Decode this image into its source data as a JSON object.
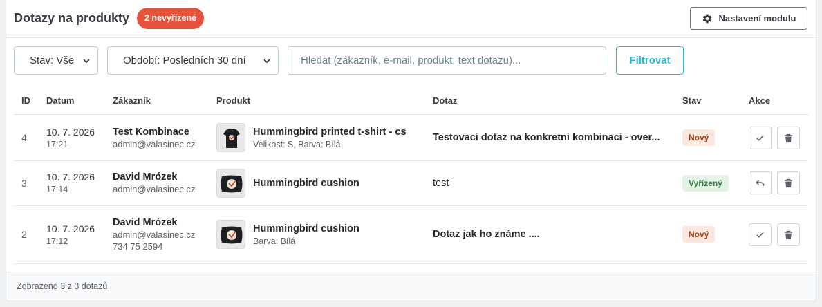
{
  "header": {
    "title": "Dotazy na produkty",
    "pending_badge": "2 nevyřízené",
    "settings_button": "Nastavení modulu"
  },
  "filters": {
    "state_select": "Stav: Vše",
    "period_select": "Období: Posledních 30 dní",
    "search_placeholder": "Hledat (zákazník, e-mail, produkt, text dotazu)...",
    "filter_button": "Filtrovat"
  },
  "table": {
    "columns": [
      "ID",
      "Datum",
      "Zákazník",
      "Produkt",
      "Dotaz",
      "Stav",
      "Akce"
    ],
    "rows": [
      {
        "id": "4",
        "date": "10. 7. 2026",
        "time": "17:21",
        "customer": "Test Kombinace",
        "email": "admin@valasinec.cz",
        "phone": "",
        "product": "Hummingbird printed t-shirt - cs",
        "variant": "Velikost: S, Barva: Bílá",
        "question": "Testovaci dotaz na konkretni kombinaci - over...",
        "status": "Nový",
        "action": "check-icon"
      },
      {
        "id": "3",
        "date": "10. 7. 2026",
        "time": "17:14",
        "customer": "David Mrózek",
        "email": "admin@valasinec.cz",
        "phone": "",
        "product": "Hummingbird cushion",
        "variant": "",
        "question": "test",
        "status": "Vyřízený",
        "action": "undo-icon"
      },
      {
        "id": "2",
        "date": "10. 7. 2026",
        "time": "17:12",
        "customer": "David Mrózek",
        "email": "admin@valasinec.cz",
        "phone": "734 75 2594",
        "product": "Hummingbird cushion",
        "variant": "Barva: Bílá",
        "question": "Dotaz jak ho známe ....",
        "status": "Nový",
        "action": "check-icon"
      }
    ]
  },
  "footer": {
    "summary": "Zobrazeno 3 z 3 dotazů"
  },
  "colors": {
    "accent": "#25b9d7",
    "badge": "#e5533d",
    "new": "#a33c14",
    "done": "#2d7a3a"
  }
}
